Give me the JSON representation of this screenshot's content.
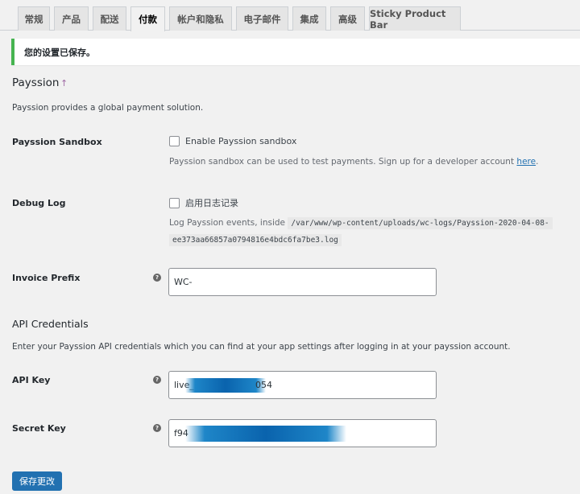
{
  "tabs": [
    {
      "label": "常规"
    },
    {
      "label": "产品"
    },
    {
      "label": "配送"
    },
    {
      "label": "付款"
    },
    {
      "label": "帐户和隐私"
    },
    {
      "label": "电子邮件"
    },
    {
      "label": "集成"
    },
    {
      "label": "高级"
    },
    {
      "label": "Sticky Product Bar"
    }
  ],
  "active_tab": "付款",
  "notice": "您的设置已保存。",
  "section": {
    "title": "Payssion",
    "title_link_icon": "↑",
    "description": "Payssion provides a global payment solution."
  },
  "sandbox": {
    "label": "Payssion Sandbox",
    "checkbox_label": "Enable Payssion sandbox",
    "checked": false,
    "help_prefix": "Payssion sandbox can be used to test payments. Sign up for a developer account ",
    "help_link": "here",
    "help_suffix": "."
  },
  "debug": {
    "label": "Debug Log",
    "checkbox_label": "启用日志记录",
    "checked": false,
    "help_prefix": "Log Payssion events, inside ",
    "path_line1": "/var/www/wp-content/uploads/wc-logs/Payssion-2020-04-08-",
    "path_line2": "ee373aa66857a0794816e4bdc6fa7be3.log"
  },
  "invoice": {
    "label": "Invoice Prefix",
    "value": "WC-"
  },
  "api": {
    "title": "API Credentials",
    "description": "Enter your Payssion API credentials which you can find at your app settings after logging in at your payssion account.",
    "key_label": "API Key",
    "key_prefix": "live_",
    "key_suffix": "054",
    "secret_label": "Secret Key",
    "secret_prefix": "f94"
  },
  "help_tip": "?",
  "save_button": "保存更改",
  "colors": {
    "accent": "#2271b1",
    "notice_success": "#46b450",
    "link_icon": "#a06ba5"
  }
}
